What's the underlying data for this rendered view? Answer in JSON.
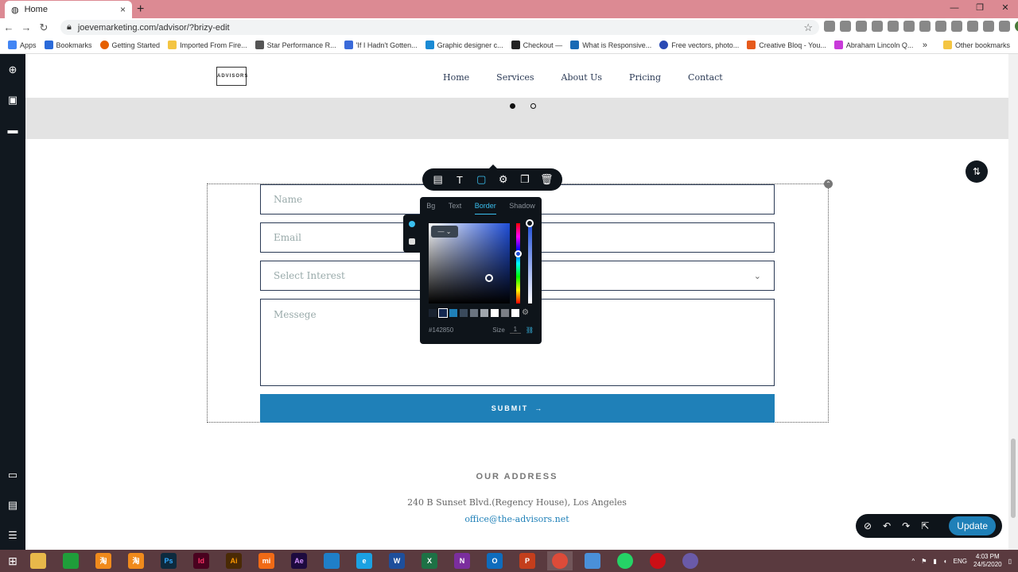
{
  "browser": {
    "tab_title": "Home",
    "tab_close": "×",
    "new_tab": "+",
    "url": "joevemarketing.com/advisor/?brizy-edit",
    "window_controls": [
      "—",
      "❐",
      "✕"
    ]
  },
  "bookmarks": [
    "Apps",
    "Bookmarks",
    "Getting Started",
    "Imported From Fire...",
    "Star Performance R...",
    "'If I Hadn't Gotten...",
    "Graphic designer c...",
    "Checkout —",
    "What is Responsive...",
    "Free vectors, photo...",
    "Creative Bloq - You...",
    "Abraham Lincoln Q..."
  ],
  "other_bookmarks": "Other bookmarks",
  "bookmarks_more": "»",
  "site": {
    "logo": "ADVISORS",
    "nav": [
      "Home",
      "Services",
      "About Us",
      "Pricing",
      "Contact"
    ]
  },
  "form": {
    "name_placeholder": "Name",
    "email_placeholder": "Email",
    "select_placeholder": "Select Interest",
    "message_placeholder": "Messege",
    "submit": "SUBMIT",
    "submit_arrow": "→"
  },
  "color_panel": {
    "tabs": [
      "Bg",
      "Text",
      "Border",
      "Shadow"
    ],
    "active_tab": "Border",
    "style_select": "— ⌄",
    "hex": "#142850",
    "size_label": "Size",
    "size_value": "1",
    "swatches": [
      "#1a2330",
      "#142850",
      "#1f80b8",
      "#3a4a5c",
      "#6a7480",
      "#a0a6ad",
      "#ffffff",
      "#7b7f86",
      "#ffffff"
    ]
  },
  "address": {
    "title": "OUR ADDRESS",
    "line": "240 B Sunset Blvd.(Regency House), Los Angeles",
    "email": "office@the-advisors.net"
  },
  "builder": {
    "update": "Update"
  },
  "tray": {
    "lang": "ENG",
    "time": "4:03 PM",
    "date": "24/5/2020"
  },
  "taskbar_apps": [
    {
      "label": "",
      "color": "#e8b84a"
    },
    {
      "label": "",
      "color": "#1f9e3a"
    },
    {
      "label": "淘",
      "color": "#f08a1c"
    },
    {
      "label": "淘",
      "color": "#f08a1c"
    },
    {
      "label": "Ps",
      "color": "#0d2a3e"
    },
    {
      "label": "Id",
      "color": "#49021f"
    },
    {
      "label": "Ai",
      "color": "#4a2a05"
    },
    {
      "label": "mi",
      "color": "#f06a16"
    },
    {
      "label": "Ae",
      "color": "#1d0a3e"
    },
    {
      "label": "",
      "color": "#1f7fc8"
    },
    {
      "label": "e",
      "color": "#1ba1e2"
    },
    {
      "label": "W",
      "color": "#1e4f9c"
    },
    {
      "label": "X",
      "color": "#1e7145"
    },
    {
      "label": "N",
      "color": "#7b2e9e"
    },
    {
      "label": "O",
      "color": "#0f6cbd"
    },
    {
      "label": "P",
      "color": "#c43e1c"
    },
    {
      "label": "",
      "color": "#dd4b39"
    },
    {
      "label": "",
      "color": "#4a90d9"
    },
    {
      "label": "",
      "color": "#25d366"
    },
    {
      "label": "",
      "color": "#cc0f16"
    },
    {
      "label": "",
      "color": "#6a5aa8"
    }
  ]
}
